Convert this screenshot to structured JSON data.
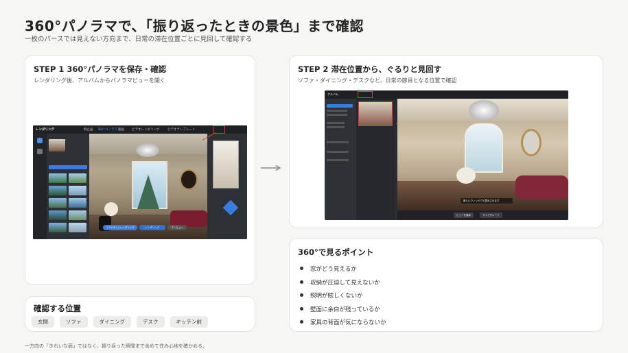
{
  "header": {
    "title": "360°パノラマで、「振り返ったときの景色」まで確認",
    "subtitle": "一枚のパースでは見えない方向まで、日常の滞在位置ごとに見回して確認する"
  },
  "step1": {
    "title": "STEP 1  360°パノラマを保存・確認",
    "description": "レンダリング後、アルバムからパノラマビューを開く",
    "screenshot": {
      "app_name": "レンダリング",
      "tabs": [
        "静止画",
        "360°パノラマ",
        "動画",
        "ビデオレンダリング",
        "ビデオテンプレート"
      ],
      "render_label": "リアルタイムレンダリング",
      "render_button": "レンダリング",
      "preview_button": "プレビュー"
    }
  },
  "step2": {
    "title": "STEP 2  滞在位置から、ぐるりと見回す",
    "description": "ソファ・ダイニング・デスクなど、日常の節目となる位置で確認",
    "screenshot": {
      "app_name": "アルバム",
      "toast": "新しいウィンドウで表示されます",
      "save_view": "ビューを保存",
      "upgrade": "アップグレード"
    }
  },
  "points": {
    "title": "360°で見るポイント",
    "items": [
      "窓がどう見えるか",
      "収納が圧迫して見えないか",
      "照明が眩しくないか",
      "壁面に余白が残っているか",
      "家具の背面が気にならないか"
    ]
  },
  "positions": {
    "title": "確認する位置",
    "chips": [
      "玄関",
      "ソファ",
      "ダイニング",
      "デスク",
      "キッチン前"
    ]
  },
  "footnote": "一方向の「きれいな面」ではなく、振り返った瞬間まで含めて住み心地を確かめる。",
  "colors": {
    "background": "#f6f6f4",
    "card": "#ffffff",
    "highlight_red": "#e23a3a",
    "accent_blue": "#3a7be0"
  }
}
